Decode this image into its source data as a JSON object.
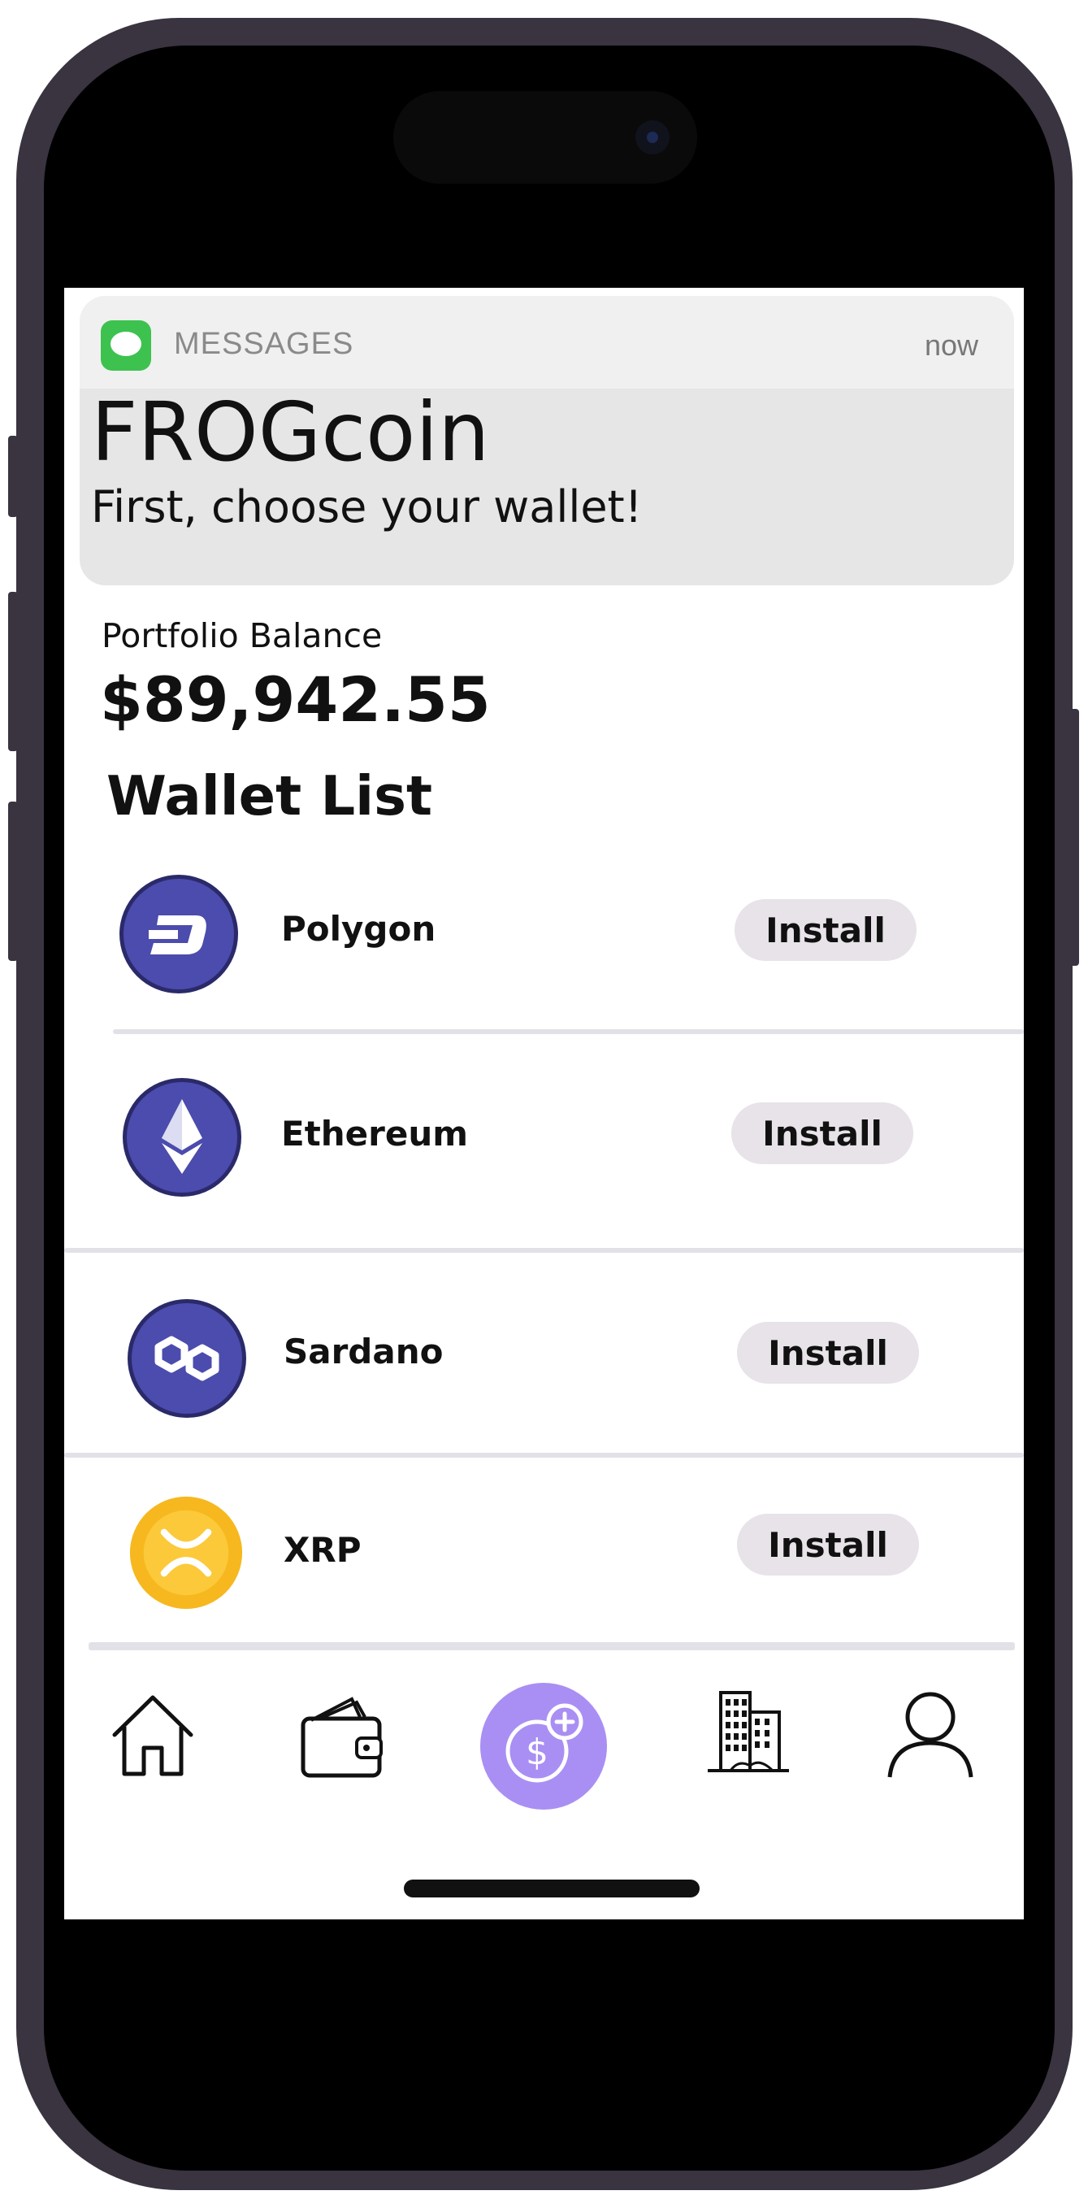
{
  "notification": {
    "app": "MESSAGES",
    "time": "now",
    "title": "FROGcoin",
    "body": "First, choose your wallet!",
    "icon": "messages-icon"
  },
  "portfolio": {
    "label": "Portfolio Balance",
    "value": "$89,942.55"
  },
  "wallet_list": {
    "title": "Wallet List",
    "items": [
      {
        "name": "Polygon",
        "action": "Install",
        "icon": "dash-coin-icon",
        "color": "#4b4cad"
      },
      {
        "name": "Ethereum",
        "action": "Install",
        "icon": "ethereum-coin-icon",
        "color": "#4b4cad"
      },
      {
        "name": "Sardano",
        "action": "Install",
        "icon": "polygon-coin-icon",
        "color": "#4b4cad"
      },
      {
        "name": "XRP",
        "action": "Install",
        "icon": "xrp-coin-icon",
        "color": "#f6b81e"
      }
    ]
  },
  "tabbar": {
    "items": [
      "home-icon",
      "wallet-icon",
      "add-dollar-icon",
      "buildings-icon",
      "profile-icon"
    ],
    "accent": "#a98ff3"
  }
}
